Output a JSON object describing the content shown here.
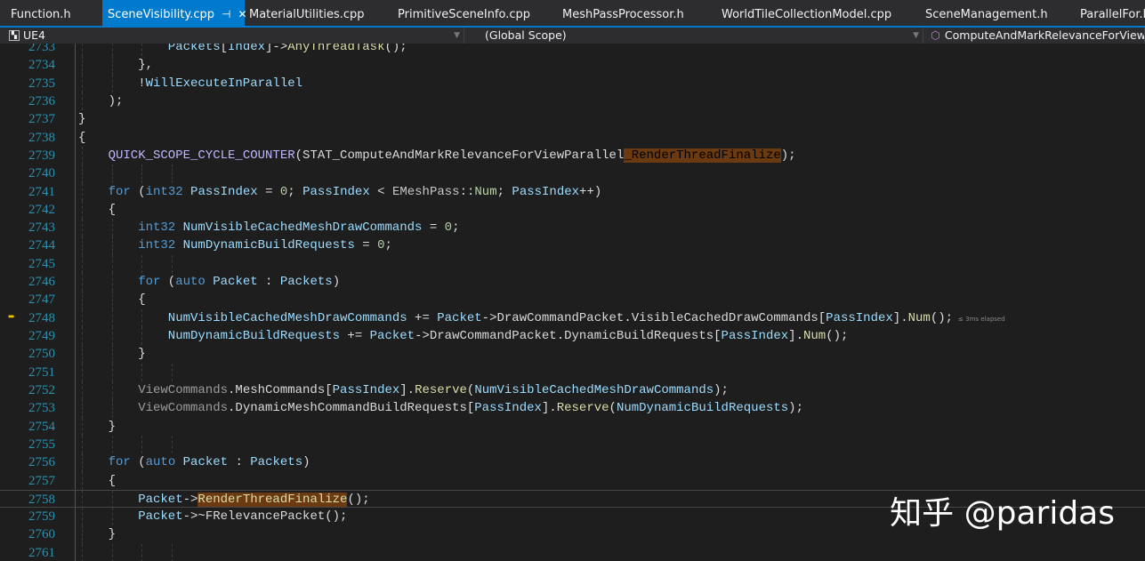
{
  "tabs": [
    {
      "label": "Function.h",
      "active": false
    },
    {
      "label": "SceneVisibility.cpp",
      "active": true
    },
    {
      "label": "MaterialUtilities.cpp",
      "active": false
    },
    {
      "label": "PrimitiveSceneInfo.cpp",
      "active": false
    },
    {
      "label": "MeshPassProcessor.h",
      "active": false
    },
    {
      "label": "WorldTileCollectionModel.cpp",
      "active": false
    },
    {
      "label": "SceneManagement.h",
      "active": false
    },
    {
      "label": "ParallelFor.h",
      "active": false
    }
  ],
  "nav": {
    "project": "UE4",
    "scope": "(Global Scope)",
    "function": "ComputeAndMarkRelevanceForViewParallel"
  },
  "colors": {
    "accent": "#007acc",
    "editor_bg": "#1e1e1e",
    "line_number": "#2b91af",
    "highlight": "#6b3a10"
  },
  "code": [
    {
      "n": "2733",
      "i": 4,
      "t": [
        [
          "var",
          "Packets"
        ],
        [
          "pl",
          "["
        ],
        [
          "var",
          "Index"
        ],
        [
          "pl",
          "]->"
        ],
        [
          "fn",
          "AnyThreadTask"
        ],
        [
          "pl",
          "();"
        ]
      ]
    },
    {
      "n": "2734",
      "i": 3,
      "t": [
        [
          "pl",
          "},"
        ]
      ]
    },
    {
      "n": "2735",
      "i": 3,
      "t": [
        [
          "pl",
          "!"
        ],
        [
          "var",
          "WillExecuteInParallel"
        ]
      ]
    },
    {
      "n": "2736",
      "i": 2,
      "t": [
        [
          "pl",
          ");"
        ]
      ]
    },
    {
      "n": "2737",
      "i": 1,
      "t": [
        [
          "pl",
          "}"
        ]
      ]
    },
    {
      "n": "2738",
      "i": 1,
      "t": [
        [
          "pl",
          "{"
        ]
      ]
    },
    {
      "n": "2739",
      "i": 2,
      "t": [
        [
          "mac",
          "QUICK_SCOPE_CYCLE_COUNTER"
        ],
        [
          "pl",
          "(STAT_ComputeAndMarkRelevanceForViewParallel"
        ],
        [
          "hl",
          "_RenderThreadFinalize"
        ],
        [
          "pl",
          ");"
        ]
      ]
    },
    {
      "n": "2740",
      "i": 0,
      "t": []
    },
    {
      "n": "2741",
      "i": 2,
      "t": [
        [
          "kw",
          "for"
        ],
        [
          "pl",
          " ("
        ],
        [
          "kw",
          "int32"
        ],
        [
          "pl",
          " "
        ],
        [
          "var",
          "PassIndex"
        ],
        [
          "pl",
          " = "
        ],
        [
          "nm",
          "0"
        ],
        [
          "pl",
          "; "
        ],
        [
          "var",
          "PassIndex"
        ],
        [
          "pl",
          " < "
        ],
        [
          "ty",
          "EMeshPass"
        ],
        [
          "pl",
          "::"
        ],
        [
          "en",
          "Num"
        ],
        [
          "pl",
          "; "
        ],
        [
          "var",
          "PassIndex"
        ],
        [
          "pl",
          "++)"
        ]
      ]
    },
    {
      "n": "2742",
      "i": 2,
      "t": [
        [
          "pl",
          "{"
        ]
      ]
    },
    {
      "n": "2743",
      "i": 3,
      "t": [
        [
          "kw",
          "int32"
        ],
        [
          "pl",
          " "
        ],
        [
          "var",
          "NumVisibleCachedMeshDrawCommands"
        ],
        [
          "pl",
          " = "
        ],
        [
          "nm",
          "0"
        ],
        [
          "pl",
          ";"
        ]
      ]
    },
    {
      "n": "2744",
      "i": 3,
      "t": [
        [
          "kw",
          "int32"
        ],
        [
          "pl",
          " "
        ],
        [
          "var",
          "NumDynamicBuildRequests"
        ],
        [
          "pl",
          " = "
        ],
        [
          "nm",
          "0"
        ],
        [
          "pl",
          ";"
        ]
      ]
    },
    {
      "n": "2745",
      "i": 0,
      "t": []
    },
    {
      "n": "2746",
      "i": 3,
      "t": [
        [
          "kw",
          "for"
        ],
        [
          "pl",
          " ("
        ],
        [
          "kw",
          "auto"
        ],
        [
          "pl",
          " "
        ],
        [
          "var",
          "Packet"
        ],
        [
          "pl",
          " : "
        ],
        [
          "var",
          "Packets"
        ],
        [
          "pl",
          ")"
        ]
      ]
    },
    {
      "n": "2747",
      "i": 3,
      "t": [
        [
          "pl",
          "{"
        ]
      ]
    },
    {
      "n": "2748",
      "i": 4,
      "bp": true,
      "hint": "≤ 3ms elapsed",
      "t": [
        [
          "var",
          "NumVisibleCachedMeshDrawCommands"
        ],
        [
          "pl",
          " += "
        ],
        [
          "var",
          "Packet"
        ],
        [
          "pl",
          "->"
        ],
        [
          "mem",
          "DrawCommandPacket"
        ],
        [
          "pl",
          "."
        ],
        [
          "mem",
          "VisibleCachedDrawCommands"
        ],
        [
          "pl",
          "["
        ],
        [
          "var",
          "PassIndex"
        ],
        [
          "pl",
          "]."
        ],
        [
          "fn",
          "Num"
        ],
        [
          "pl",
          "();"
        ]
      ]
    },
    {
      "n": "2749",
      "i": 4,
      "t": [
        [
          "var",
          "NumDynamicBuildRequests"
        ],
        [
          "pl",
          " += "
        ],
        [
          "var",
          "Packet"
        ],
        [
          "pl",
          "->"
        ],
        [
          "mem",
          "DrawCommandPacket"
        ],
        [
          "pl",
          "."
        ],
        [
          "mem",
          "DynamicBuildRequests"
        ],
        [
          "pl",
          "["
        ],
        [
          "var",
          "PassIndex"
        ],
        [
          "pl",
          "]."
        ],
        [
          "fn",
          "Num"
        ],
        [
          "pl",
          "();"
        ]
      ]
    },
    {
      "n": "2750",
      "i": 3,
      "t": [
        [
          "pl",
          "}"
        ]
      ]
    },
    {
      "n": "2751",
      "i": 0,
      "t": []
    },
    {
      "n": "2752",
      "i": 3,
      "t": [
        [
          "gray",
          "ViewCommands"
        ],
        [
          "pl",
          "."
        ],
        [
          "mem",
          "MeshCommands"
        ],
        [
          "pl",
          "["
        ],
        [
          "var",
          "PassIndex"
        ],
        [
          "pl",
          "]."
        ],
        [
          "fn",
          "Reserve"
        ],
        [
          "pl",
          "("
        ],
        [
          "var",
          "NumVisibleCachedMeshDrawCommands"
        ],
        [
          "pl",
          ");"
        ]
      ]
    },
    {
      "n": "2753",
      "i": 3,
      "t": [
        [
          "gray",
          "ViewCommands"
        ],
        [
          "pl",
          "."
        ],
        [
          "mem",
          "DynamicMeshCommandBuildRequests"
        ],
        [
          "pl",
          "["
        ],
        [
          "var",
          "PassIndex"
        ],
        [
          "pl",
          "]."
        ],
        [
          "fn",
          "Reserve"
        ],
        [
          "pl",
          "("
        ],
        [
          "var",
          "NumDynamicBuildRequests"
        ],
        [
          "pl",
          ");"
        ]
      ]
    },
    {
      "n": "2754",
      "i": 2,
      "t": [
        [
          "pl",
          "}"
        ]
      ]
    },
    {
      "n": "2755",
      "i": 0,
      "t": []
    },
    {
      "n": "2756",
      "i": 2,
      "t": [
        [
          "kw",
          "for"
        ],
        [
          "pl",
          " ("
        ],
        [
          "kw",
          "auto"
        ],
        [
          "pl",
          " "
        ],
        [
          "var",
          "Packet"
        ],
        [
          "pl",
          " : "
        ],
        [
          "var",
          "Packets"
        ],
        [
          "pl",
          ")"
        ]
      ]
    },
    {
      "n": "2757",
      "i": 2,
      "t": [
        [
          "pl",
          "{"
        ]
      ]
    },
    {
      "n": "2758",
      "i": 3,
      "cur": true,
      "t": [
        [
          "var",
          "Packet"
        ],
        [
          "pl",
          "->"
        ],
        [
          "hlfn",
          "RenderThreadFinalize"
        ],
        [
          "pl",
          "();"
        ]
      ]
    },
    {
      "n": "2759",
      "i": 3,
      "t": [
        [
          "var",
          "Packet"
        ],
        [
          "pl",
          "->~"
        ],
        [
          "mem",
          "FRelevancePacket"
        ],
        [
          "pl",
          "();"
        ]
      ]
    },
    {
      "n": "2760",
      "i": 2,
      "t": [
        [
          "pl",
          "}"
        ]
      ]
    },
    {
      "n": "2761",
      "i": 0,
      "t": []
    }
  ],
  "watermark": "知乎 @paridas"
}
